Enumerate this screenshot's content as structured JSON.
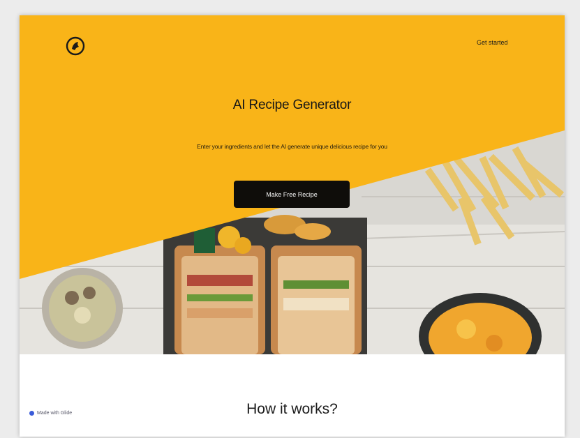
{
  "colors": {
    "hero_yellow": "#f9b418",
    "button_black": "#0f0d0a",
    "page_white": "#ffffff"
  },
  "header": {
    "logo_icon": "chef-bird-logo-icon",
    "signin_label": "Get started"
  },
  "hero": {
    "title": "AI Recipe Generator",
    "subtitle": "Enter your ingredients and let the AI generate unique delicious recipe for you",
    "cta_label": "Make Free Recipe",
    "image_icon": "food-spread-photo"
  },
  "section": {
    "heading": "How it works?"
  },
  "footer_badge": {
    "label": "Made with Glide"
  }
}
